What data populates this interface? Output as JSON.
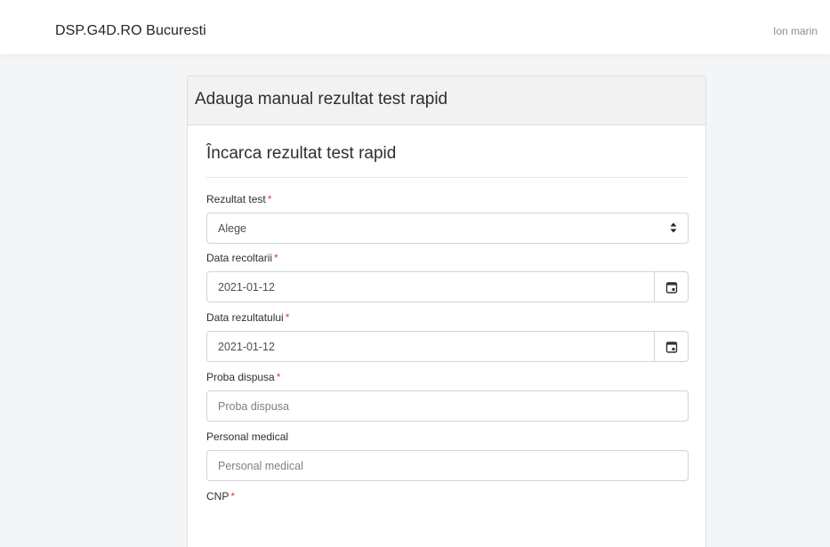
{
  "navbar": {
    "brand": "DSP.G4D.RO Bucuresti",
    "user": "Ion marin"
  },
  "card": {
    "header": "Adauga manual rezultat test rapid",
    "section_title": "Încarca rezultat test rapid",
    "required_mark": "*",
    "fields": {
      "rezultat_test": {
        "label": "Rezultat test",
        "value": "Alege"
      },
      "data_recoltarii": {
        "label": "Data recoltarii",
        "value": "2021-01-12"
      },
      "data_rezultatului": {
        "label": "Data rezultatului",
        "value": "2021-01-12"
      },
      "proba_dispusa": {
        "label": "Proba dispusa",
        "placeholder": "Proba dispusa"
      },
      "personal_medical": {
        "label": "Personal medical",
        "placeholder": "Personal medical"
      },
      "cnp": {
        "label": "CNP"
      }
    }
  },
  "colors": {
    "accent_required": "#e33d3d",
    "border": "#ced4da",
    "page_bg": "#f4f5f7"
  }
}
